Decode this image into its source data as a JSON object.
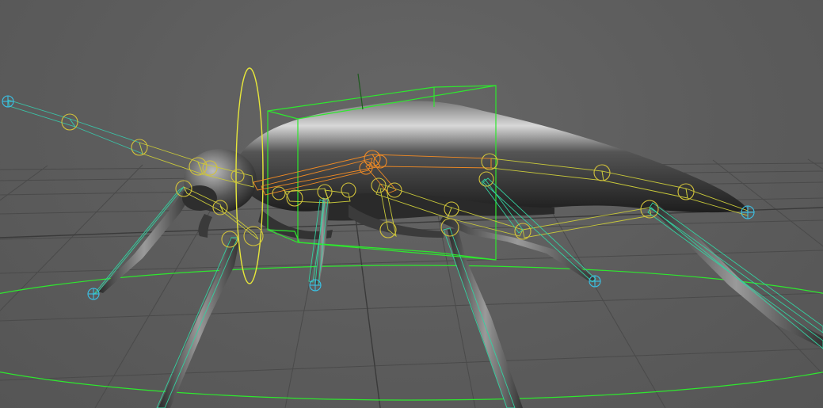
{
  "viewport": {
    "panel": "perspective-viewport",
    "background_color": "#5d5d5d",
    "grid_color": "#494949",
    "grid_axis_color": "#3c3c3c"
  },
  "scene": {
    "model": "insect-mesh",
    "model_color": "#4a4a4a",
    "joint_colors": {
      "spine": "#f08a24",
      "limb": "#c8c83a",
      "bone_outline": "#34d0a0",
      "locator": "#3ac2e6"
    },
    "controls": {
      "bounding_box_color": "#2ee82e",
      "root_ring_color": "#2ee82e",
      "rotate_ring_color": "#e6e63a"
    }
  }
}
